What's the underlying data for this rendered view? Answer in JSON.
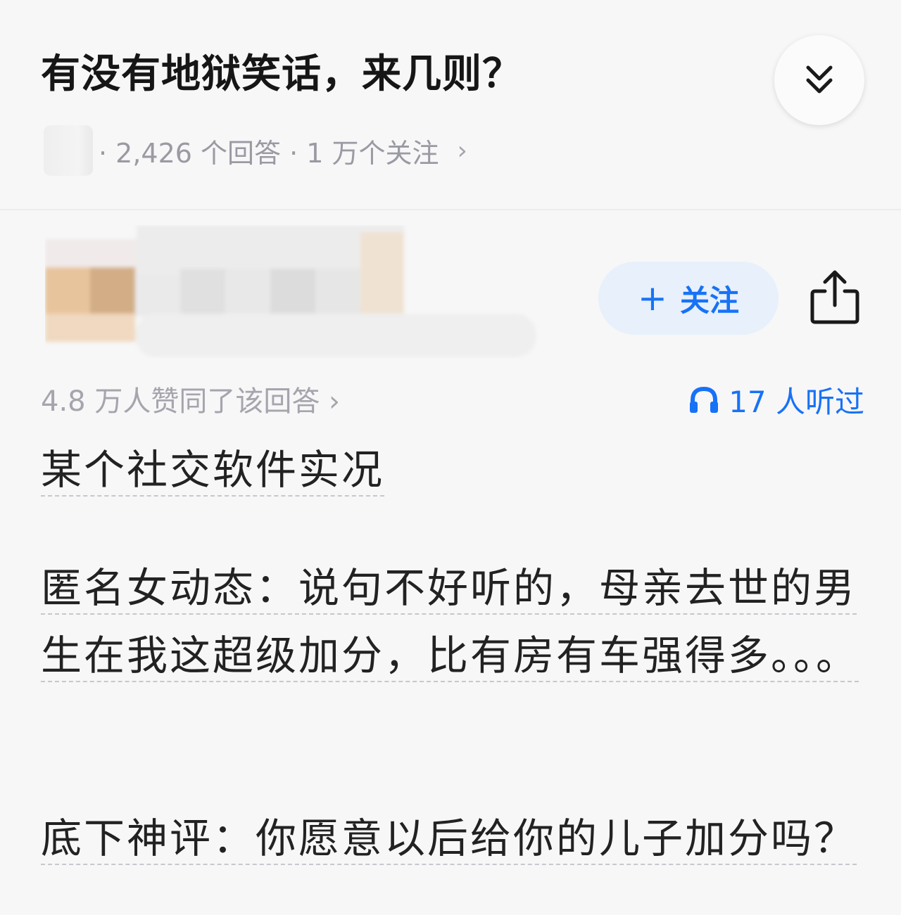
{
  "question": {
    "title": "有没有地狱笑话，来几则？",
    "meta": "· 2,426 个回答 · 1 万个关注",
    "meta_chevron": "›"
  },
  "answer": {
    "follow_label": "关注",
    "follow_plus": "+",
    "votes": "4.8 万人赞同了该回答 ›",
    "listens": "17 人听过",
    "paragraphs": [
      "某个社交软件实况",
      "匿名女动态：说句不好听的，母亲去世的男生在我这超级加分，比有房有车强得多。。。",
      "底下神评：你愿意以后给你的儿子加分吗？"
    ]
  },
  "icons": {
    "collapse": "double-chevron-down-icon",
    "share": "share-icon",
    "listen": "headphones-icon"
  },
  "colors": {
    "accent": "#1772f6",
    "follow_bg": "#e7f0fb",
    "muted_text": "#9a9aa3",
    "background": "#f7f7f8"
  }
}
